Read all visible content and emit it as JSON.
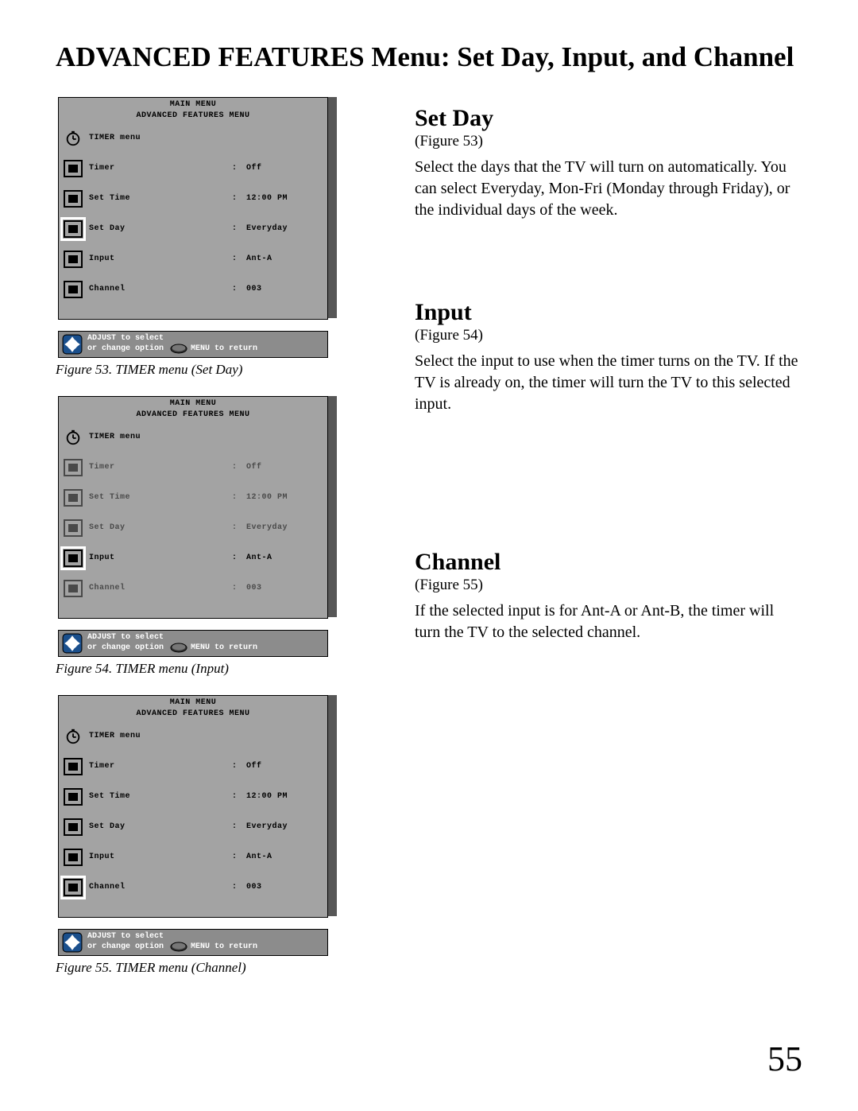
{
  "page_title": "ADVANCED FEATURES Menu: Set Day, Input, and Channel",
  "page_number": "55",
  "osd": {
    "main_menu_label": "MAIN MENU",
    "adv_menu_label": "ADVANCED FEATURES MENU",
    "timer_menu_label": "TIMER menu",
    "rows": [
      {
        "label": "Timer",
        "value": "Off"
      },
      {
        "label": "Set Time",
        "value": "12:00 PM"
      },
      {
        "label": "Set Day",
        "value": "Everyday"
      },
      {
        "label": "Input",
        "value": "Ant-A"
      },
      {
        "label": "Channel",
        "value": "003"
      }
    ],
    "legend": {
      "line1": "ADJUST to select",
      "line2a": "or change option",
      "line2b": "MENU to return"
    }
  },
  "figures": [
    {
      "selected_index": 2,
      "caption": "Figure 53.  TIMER menu (Set Day)"
    },
    {
      "selected_index": 3,
      "caption": "Figure 54.  TIMER menu (Input)"
    },
    {
      "selected_index": 4,
      "caption": "Figure 55.  TIMER menu (Channel)"
    }
  ],
  "sections": [
    {
      "heading": "Set Day",
      "fig_ref": "(Figure 53)",
      "body": "Select the days that the TV will turn on automatically. You can select Everyday, Mon-Fri (Monday through Friday), or the individual days of the week."
    },
    {
      "heading": "Input",
      "fig_ref": "(Figure 54)",
      "body": "Select the input to use when the timer turns on the TV.  If the TV is already on, the timer will turn the TV to this selected input."
    },
    {
      "heading": "Channel",
      "fig_ref": "(Figure 55)",
      "body": "If the selected input is for Ant-A or Ant-B, the timer will turn the TV to the selected channel."
    }
  ]
}
